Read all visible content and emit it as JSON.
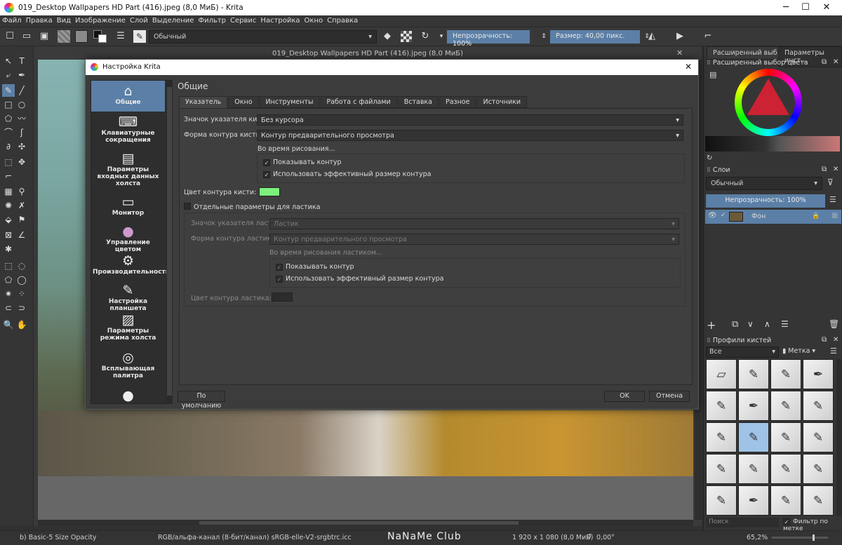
{
  "window": {
    "title": "019_Desktop Wallpapers  HD Part (416).jpeg (8,0 МиБ)  - Krita"
  },
  "menu": [
    "Файл",
    "Правка",
    "Вид",
    "Изображение",
    "Слой",
    "Выделение",
    "Фильтр",
    "Сервис",
    "Настройка",
    "Окно",
    "Справка"
  ],
  "toolbar": {
    "blend_mode": "Обычный",
    "opacity": "Непрозрачность: 100%",
    "size": "Размер: 40,00 пикс."
  },
  "document_title": "019_Desktop Wallpapers  HD Part (416).jpeg (8,0 МиБ)",
  "dialog": {
    "title": "Настройка Krita",
    "sidebar": [
      {
        "label": "Общие",
        "icon": "home-icon"
      },
      {
        "label": "Клавиатурные сокращения",
        "icon": "keyboard-icon"
      },
      {
        "label": "Параметры входных данных холста",
        "icon": "document-icon"
      },
      {
        "label": "Монитор",
        "icon": "monitor-icon"
      },
      {
        "label": "Управление цветом",
        "icon": "color-circle-icon"
      },
      {
        "label": "Производительность",
        "icon": "gears-icon"
      },
      {
        "label": "Настройка планшета",
        "icon": "tablet-pen-icon"
      },
      {
        "label": "Параметры режима холста",
        "icon": "image-icon"
      },
      {
        "label": "Всплывающая палитра",
        "icon": "palette-icon"
      },
      {
        "label": "",
        "icon": "user-icon"
      }
    ],
    "page_title": "Общие",
    "tabs": [
      "Указатель",
      "Окно",
      "Инструменты",
      "Работа с файлами",
      "Вставка",
      "Разное",
      "Источники"
    ],
    "cursor": {
      "brush_icon_label": "Значок указателя кисти:",
      "brush_icon_value": "Без курсора",
      "outline_label": "Форма контура кисти:",
      "outline_value": "Контур предварительного просмотра",
      "while_painting": "Во время рисования...",
      "show_outline": "Показывать контур",
      "use_effective": "Использовать эффективный размер контура",
      "outline_color_label": "Цвет контура кисти:",
      "outline_color": "#7cf07c",
      "separate_eraser": "Отдельные параметры для ластика",
      "eraser_icon_label": "Значок указателя ластика:",
      "eraser_icon_value": "Ластик",
      "eraser_outline_label": "Форма контура ластика:",
      "eraser_outline_value": "Контур предварительного просмотра",
      "while_erasing": "Во время рисования ластиком...",
      "eraser_show_outline": "Показывать контур",
      "eraser_use_effective": "Использовать эффективный размер контура",
      "eraser_color_label": "Цвет контура ластика:"
    },
    "defaults_button": "По умолчанию",
    "ok_button": "OK",
    "cancel_button": "Отмена"
  },
  "right_panel": {
    "tabs": [
      "Расширенный выб...",
      "Параметры инст..."
    ],
    "color_selector_title": "Расширенный выбор цвета",
    "layers_title": "Слои",
    "layer_blend": "Обычный",
    "layer_opacity": "Непрозрачность:  100%",
    "layer_name": "Фон",
    "brush_presets_title": "Профили кистей",
    "brush_filter": "Все",
    "tag_label": "Метка",
    "search_placeholder": "Поиск",
    "filter_by_tag": "Фильтр по метке"
  },
  "status": {
    "brush": "b) Basic-5 Size Opacity",
    "color_model": "RGB/альфа-канал (8-бит/канал)  sRGB-elle-V2-srgbtrc.icc",
    "dimensions": "1 920 x 1 080 (8,0 МиБ)",
    "rotation": "0,00°",
    "zoom": "65,2%",
    "watermark": "NaNaMe Club"
  }
}
